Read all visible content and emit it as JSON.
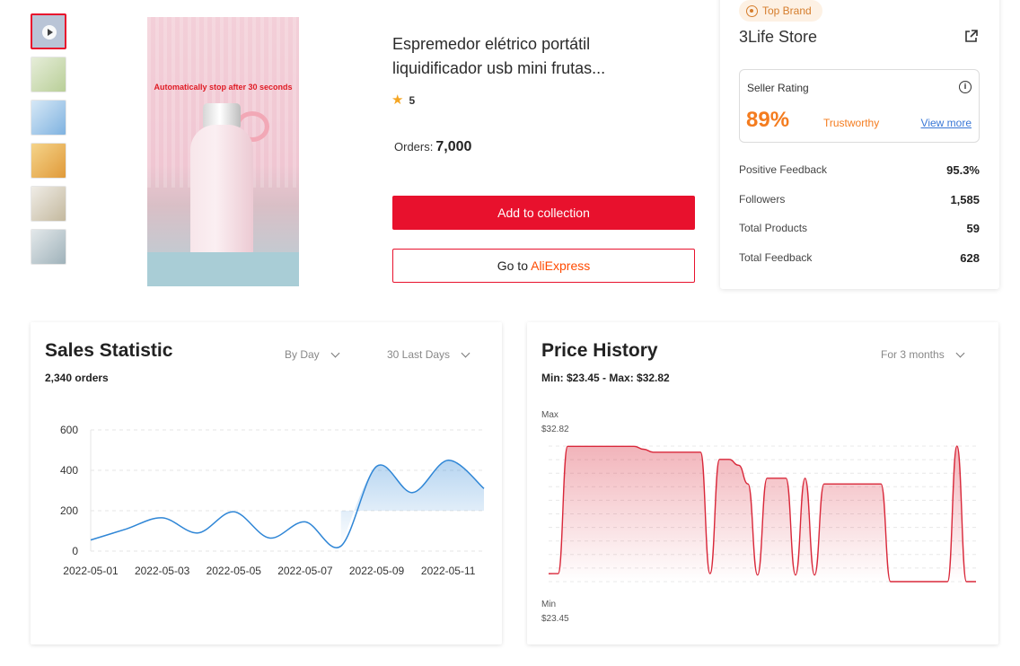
{
  "product": {
    "title": "Espremedor elétrico portátil liquidificador usb mini frutas...",
    "rating": "5",
    "orders_label": "Orders:",
    "orders_value": "7,000",
    "image_overlay_text": "Automatically stop after 30 seconds",
    "add_button": "Add to collection",
    "goto_prefix": "Go to",
    "goto_brand": "AliExpress"
  },
  "thumbnails": [
    {
      "name": "video",
      "color": "#b9c4d6"
    },
    {
      "name": "product-2",
      "color": "#c9d9b0"
    },
    {
      "name": "product-3",
      "color": "#a9c9e6"
    },
    {
      "name": "product-4",
      "color": "#e6b96a"
    },
    {
      "name": "product-5",
      "color": "#d8d3c7"
    },
    {
      "name": "product-6",
      "color": "#c3cfd4"
    }
  ],
  "store": {
    "badge": "Top Brand",
    "name": "3Life Store",
    "seller_rating_label": "Seller Rating",
    "seller_rating_value": "89%",
    "trust_label": "Trustworthy",
    "view_more": "View more",
    "stats": [
      {
        "label": "Positive Feedback",
        "value": "95.3%"
      },
      {
        "label": "Followers",
        "value": "1,585"
      },
      {
        "label": "Total Products",
        "value": "59"
      },
      {
        "label": "Total Feedback",
        "value": "628"
      }
    ]
  },
  "sales": {
    "title": "Sales Statistic",
    "orders": "2,340 orders",
    "filter_period": "By Day",
    "filter_range": "30 Last Days"
  },
  "price": {
    "title": "Price History",
    "range_text": "Min: $23.45 - Max: $32.82",
    "filter": "For 3 months",
    "max_label": "Max",
    "max_value": "$32.82",
    "min_label": "Min",
    "min_value": "$23.45"
  },
  "colors": {
    "accent_red": "#e8112d",
    "rating_orange": "#f47c1f",
    "sales_line": "#2f86d6",
    "price_line": "#d9283a"
  },
  "chart_data": [
    {
      "type": "area",
      "x": [
        "2022-05-01",
        "2022-05-02",
        "2022-05-03",
        "2022-05-04",
        "2022-05-05",
        "2022-05-06",
        "2022-05-07",
        "2022-05-08",
        "2022-05-09",
        "2022-05-10",
        "2022-05-11",
        "2022-05-12"
      ],
      "x_tick_labels": [
        "2022-05-01",
        "2022-05-03",
        "2022-05-05",
        "2022-05-07",
        "2022-05-09",
        "2022-05-11"
      ],
      "y_ticks": [
        0,
        200,
        400,
        600
      ],
      "ylim": [
        0,
        600
      ],
      "values": [
        55,
        110,
        165,
        90,
        195,
        65,
        145,
        25,
        420,
        290,
        450,
        310
      ],
      "grid": true
    },
    {
      "type": "area",
      "ylim": [
        23.45,
        32.82
      ],
      "values": [
        24.0,
        24.0,
        32.8,
        32.8,
        32.8,
        32.8,
        32.8,
        32.8,
        32.8,
        32.8,
        32.6,
        32.4,
        32.4,
        32.4,
        32.4,
        32.4,
        32.4,
        24.0,
        31.9,
        31.9,
        31.5,
        30.2,
        23.9,
        30.6,
        30.6,
        30.6,
        23.9,
        30.6,
        23.9,
        30.2,
        30.2,
        30.2,
        30.2,
        30.2,
        30.2,
        30.2,
        23.45,
        23.45,
        23.45,
        23.45,
        23.45,
        23.45,
        23.45,
        32.82,
        23.45,
        23.45
      ],
      "grid": true
    }
  ]
}
